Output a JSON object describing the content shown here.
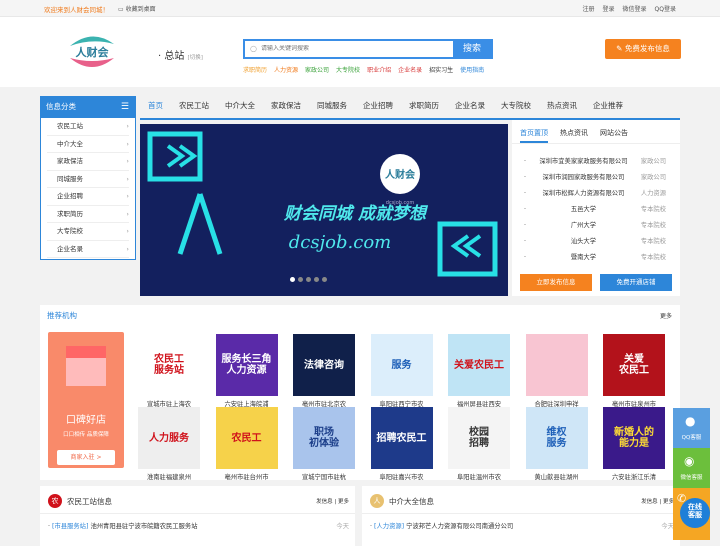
{
  "topbar": {
    "welcome": "欢迎来到人财会同城！",
    "bookmark": "收藏到桌面",
    "links": [
      "注册",
      "登录",
      "微信登录",
      "QQ登录"
    ]
  },
  "header": {
    "logo_text": "人财会",
    "site": "总站",
    "switch": "[切换]",
    "search_placeholder": "请输入关键词搜索",
    "search_button": "搜索",
    "hot": [
      {
        "t": "求职简历",
        "c": "#f0a030"
      },
      {
        "t": "人力资源",
        "c": "#f07a1b"
      },
      {
        "t": "家政公司",
        "c": "#3aa23a"
      },
      {
        "t": "大专院校",
        "c": "#3aa23a"
      },
      {
        "t": "职业介绍",
        "c": "#d83a3a"
      },
      {
        "t": "企业名录",
        "c": "#d83a3a"
      },
      {
        "t": "招实习生",
        "c": "#333333"
      },
      {
        "t": "使用指南",
        "c": "#2d86d9"
      }
    ],
    "publish": "免费发布信息"
  },
  "sidebar": {
    "title": "信息分类",
    "items": [
      "农民工站",
      "中介大全",
      "家政保洁",
      "同城服务",
      "企业招聘",
      "求职简历",
      "大专院校",
      "企业名录"
    ]
  },
  "nav": [
    "首页",
    "农民工站",
    "中介大全",
    "家政保洁",
    "同城服务",
    "企业招聘",
    "求职简历",
    "企业名录",
    "大专院校",
    "热点资讯",
    "企业推荐"
  ],
  "banner": {
    "logo": "人财会",
    "domain_small": "dcsjob.com",
    "slogan": "财会同城 成就梦想",
    "domain": "dcsjob.com",
    "dots": 5,
    "active_dot": 0
  },
  "right_panel": {
    "tabs": [
      "首页置顶",
      "热点资讯",
      "网站公告"
    ],
    "rows": [
      {
        "n": "深圳市宜美家家政服务有限公司",
        "c": "家政公司"
      },
      {
        "n": "深圳市润园家政服务有限公司",
        "c": "家政公司"
      },
      {
        "n": "深圳市松辉人力资源有限公司",
        "c": "人力资源"
      },
      {
        "n": "五邑大学",
        "c": "专本院校"
      },
      {
        "n": "广州大学",
        "c": "专本院校"
      },
      {
        "n": "汕头大学",
        "c": "专本院校"
      },
      {
        "n": "暨南大学",
        "c": "专本院校"
      }
    ],
    "btn1": "立即发布信息",
    "btn2": "免费开通店铺"
  },
  "recommend": {
    "title": "推荐机构",
    "more": "更多",
    "promo": {
      "title": "口碑好店",
      "sub": "口口相传 品质保障",
      "btn": "商家入驻 >"
    },
    "tiles": [
      {
        "img": "农民工\n服务站",
        "label": "宣城市驻上海农",
        "bg": "#ffffff",
        "fg": "#d0121b"
      },
      {
        "img": "服务长三角\n人力资源",
        "label": "六安驻上海皖浦",
        "bg": "#5a2aa8",
        "fg": "#ffffff"
      },
      {
        "img": "法律咨询",
        "label": "亳州市驻北京农",
        "bg": "#10204a",
        "fg": "#ffffff"
      },
      {
        "img": "服务",
        "label": "阜阳驻西宁市农",
        "bg": "#dceefb",
        "fg": "#1d5fb8"
      },
      {
        "img": "关爱农民工",
        "label": "福州屏县驻西安",
        "bg": "#bfe4f5",
        "fg": "#d0121b"
      },
      {
        "img": "",
        "label": "合肥驻深圳申祥",
        "bg": "#f8c5d2",
        "fg": "#333333"
      },
      {
        "img": "关爱\n农民工",
        "label": "亳州市驻泉州市",
        "bg": "#b3121b",
        "fg": "#ffffff"
      },
      {
        "img": "人力服务",
        "label": "淮南驻福建泉州",
        "bg": "#eeeeee",
        "fg": "#d0121b"
      },
      {
        "img": "农民工",
        "label": "亳州市驻台州市",
        "bg": "#f6d24a",
        "fg": "#d0121b"
      },
      {
        "img": "职场\n初体验",
        "label": "宣城宁国市驻杭",
        "bg": "#a9c4ec",
        "fg": "#1d3f8a"
      },
      {
        "img": "招聘农民工",
        "label": "阜阳驻嘉兴市农",
        "bg": "#1e3a8a",
        "fg": "#ffffff"
      },
      {
        "img": "校园\n招聘",
        "label": "阜阳驻温州市农",
        "bg": "#f4f4f4",
        "fg": "#333333"
      },
      {
        "img": "维权\n服务",
        "label": "黄山歙县驻湖州",
        "bg": "#cfe6f7",
        "fg": "#1d5fb8"
      },
      {
        "img": "新婚人的\n能力是",
        "label": "六安驻浙江乐清",
        "bg": "#3a1a8a",
        "fg": "#ffdd33"
      }
    ]
  },
  "boxes": [
    {
      "icon": "农",
      "title": "农民工站信息",
      "actions": "发信息 | 更多",
      "tag": "[市县服务站]",
      "item": "池州青阳县驻宁波市皖籍农民工服务站",
      "time": "今天"
    },
    {
      "icon": "人",
      "title": "中介大全信息",
      "actions": "发信息 | 更多",
      "tag": "[人力资源]",
      "item": "宁波邦芒人力资源有限公司南通分公司",
      "time": "今天"
    }
  ],
  "float": {
    "qq": "QQ客服",
    "wechat": "微信客服",
    "online": "在线\n客服"
  },
  "colors": {
    "primary": "#2d86d9",
    "orange": "#f5821f"
  }
}
